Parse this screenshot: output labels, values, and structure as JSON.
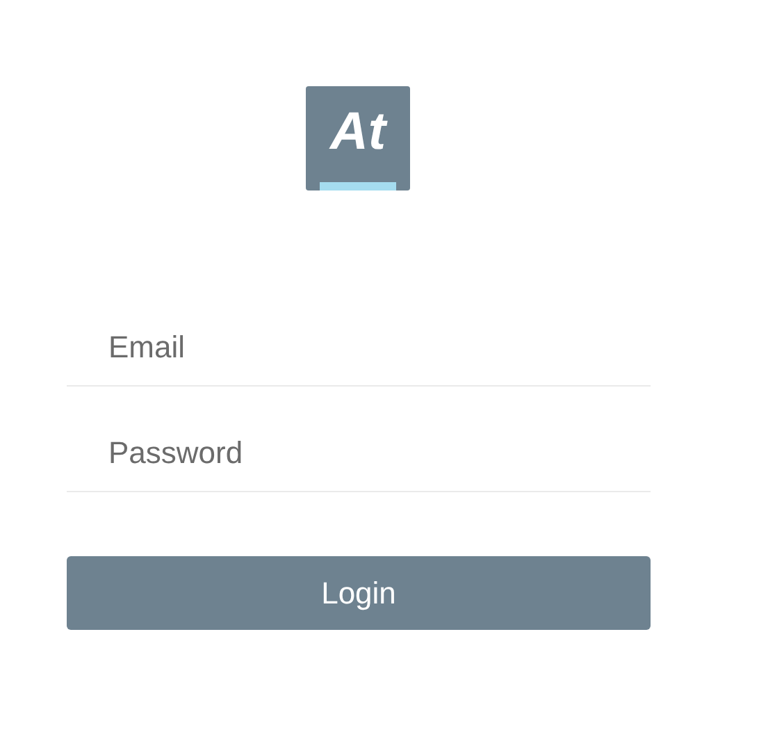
{
  "logo": {
    "text": "At"
  },
  "fields": [
    {
      "placeholder": "Email"
    },
    {
      "placeholder": "Password"
    }
  ],
  "button": {
    "label": "Login"
  }
}
